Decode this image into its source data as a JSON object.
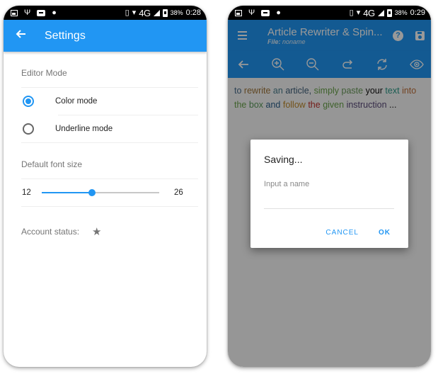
{
  "left_screen": {
    "status_bar": {
      "left_icons": [
        "image-icon",
        "usb-icon",
        "message-icon",
        "android-icon"
      ],
      "right_icons": [
        "vibrate-icon",
        "wifi-icon",
        "signal-icon",
        "battery-icon"
      ],
      "network": "4G",
      "battery": "38%",
      "time": "0:28"
    },
    "appbar": {
      "back_icon": "arrow-left-icon",
      "title": "Settings"
    },
    "settings": {
      "editor_mode_label": "Editor Mode",
      "modes": [
        {
          "label": "Color mode",
          "checked": true
        },
        {
          "label": "Underline mode",
          "checked": false
        }
      ],
      "font_size_label": "Default font size",
      "font_size": {
        "min": "12",
        "max": "26",
        "value": 18
      },
      "account_status_label": "Account status:",
      "account_status_icon": "star-icon"
    },
    "colors": {
      "accent": "#2196F3",
      "label_gray": "#757575"
    }
  },
  "right_screen": {
    "status_bar": {
      "network": "4G",
      "battery": "38%",
      "time": "0:29"
    },
    "appbar": {
      "menu_icon": "menu-icon",
      "title": "Article Rewriter & Spin...",
      "subtitle_label": "File:",
      "subtitle_value": "noname",
      "help_glyph": "?",
      "actions": [
        "help-icon",
        "save-icon"
      ]
    },
    "toolbar": {
      "tools": [
        "back-icon",
        "zoom-in-icon",
        "zoom-out-icon",
        "redo-icon",
        "sync-icon",
        "eye-icon"
      ]
    },
    "editor": {
      "words": [
        {
          "text": "to",
          "color": "#4a6d8c"
        },
        {
          "text": "rewrite",
          "color": "#a0763a"
        },
        {
          "text": "an",
          "color": "#4a7d8c"
        },
        {
          "text": "article,",
          "color": "#3e5f7a"
        },
        {
          "text": "simply",
          "color": "#6aa34a"
        },
        {
          "text": "paste",
          "color": "#6a9a5a"
        },
        {
          "text": "your",
          "color": "#111111"
        },
        {
          "text": "text",
          "color": "#2a9a88"
        },
        {
          "text": "into",
          "color": "#c0703a"
        },
        {
          "text": "the",
          "color": "#6aa34a"
        },
        {
          "text": "box",
          "color": "#5a9a5a"
        },
        {
          "text": "and",
          "color": "#2a5f8a"
        },
        {
          "text": "follow",
          "color": "#c08a2a"
        },
        {
          "text": "the",
          "color": "#c0302a"
        },
        {
          "text": "given",
          "color": "#6aa34a"
        },
        {
          "text": "instruction",
          "color": "#5a4a7a"
        },
        {
          "text": "...",
          "color": "#111111"
        }
      ]
    },
    "dialog": {
      "title": "Saving...",
      "input_placeholder": "Input a name",
      "input_value": "",
      "cancel_label": "CANCEL",
      "ok_label": "OK"
    }
  }
}
